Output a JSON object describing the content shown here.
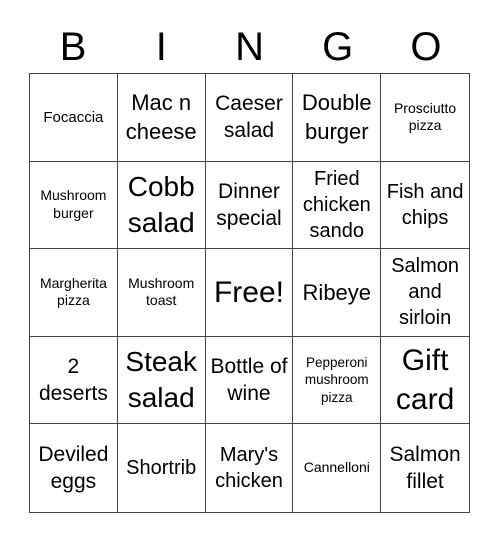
{
  "header": {
    "letters": [
      "B",
      "I",
      "N",
      "G",
      "O"
    ]
  },
  "cells": [
    "Focaccia",
    "Mac n cheese",
    "Caeser salad",
    "Double burger",
    "Prosciutto pizza",
    "Mushroom burger",
    "Cobb salad",
    "Dinner special",
    "Fried chicken sando",
    "Fish and chips",
    "Margherita pizza",
    "Mushroom toast",
    "Free!",
    "Ribeye",
    "Salmon and sirloin",
    "2 deserts",
    "Steak salad",
    "Bottle of wine",
    "Pepperoni mushroom pizza",
    "Gift card",
    "Deviled eggs",
    "Shortrib",
    "Mary's chicken",
    "Cannelloni",
    "Salmon fillet"
  ]
}
